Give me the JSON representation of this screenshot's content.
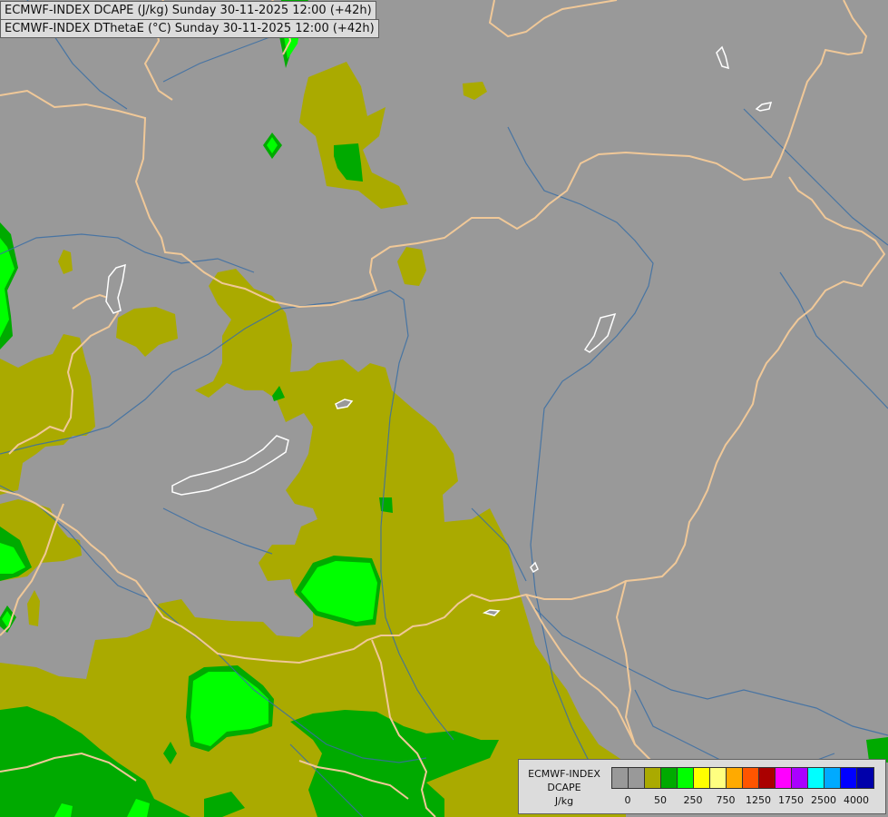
{
  "titles": {
    "line1": "ECMWF-INDEX DCAPE (J/kg) Sunday 30-11-2025 12:00 (+42h)",
    "line2": "ECMWF-INDEX DThetaE (°C) Sunday 30-11-2025 12:00 (+42h)"
  },
  "map": {
    "background_color": "#999999",
    "border_color": "#f0c898",
    "river_color": "#3a6ea5",
    "lake_color": "#ffffff",
    "fill_colors": {
      "level_50": "#aaaa00",
      "level_250": "#00aa00",
      "level_750": "#00ff00"
    }
  },
  "legend": {
    "label_lines": [
      "ECMWF-INDEX",
      "DCAPE",
      "J/kg"
    ],
    "colors": [
      "#999999",
      "#999999",
      "#aaaa00",
      "#00aa00",
      "#00ff00",
      "#ffff00",
      "#ffff80",
      "#ffaa00",
      "#ff5500",
      "#aa0000",
      "#ff00ff",
      "#aa00ff",
      "#00ffff",
      "#00aaff",
      "#0000ff",
      "#0000aa"
    ],
    "tick_labels": [
      "0",
      "50",
      "250",
      "750",
      "1250",
      "1750",
      "2500",
      "4000"
    ]
  }
}
